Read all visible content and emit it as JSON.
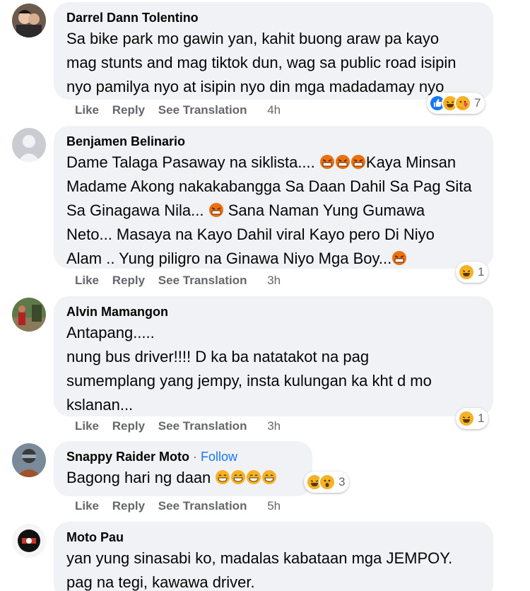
{
  "comments": [
    {
      "author": "Darrel Dann Tolentino",
      "lines": [
        "Sa bike park mo gawin yan, kahit buong araw pa kayo",
        "mag stunts and mag tiktok dun, wag sa public road isipin",
        "nyo pamilya nyo at isipin nyo din mga madadamay nyo"
      ],
      "actions": {
        "like": "Like",
        "reply": "Reply",
        "translate": "See Translation",
        "time": "4h"
      },
      "reaction_count": "7",
      "reaction_icons": [
        "like-reaction-icon",
        "haha-reaction-icon",
        "care-reaction-icon"
      ]
    },
    {
      "author": "Benjamen Belinario",
      "lines": [
        "Dame Talaga Pasaway na siklista....",
        "Kaya Minsan",
        "Madame Akong nakakabangga Sa Daan Dahil Sa Pag Sita",
        "Sa Ginagawa Nila...",
        "Sana Naman Yung Gumawa",
        "Neto... Masaya na Kayo Dahil viral Kayo pero Di Niyo",
        "Alam .. Yung piligro na Ginawa Niyo Mga Boy..."
      ],
      "actions": {
        "like": "Like",
        "reply": "Reply",
        "translate": "See Translation",
        "time": "3h"
      },
      "reaction_count": "1",
      "reaction_icons": [
        "haha-reaction-icon"
      ]
    },
    {
      "author": "Alvin Mamangon",
      "lines": [
        "Antapang.....",
        "nung bus driver!!!! D ka ba natatakot na pag",
        "sumemplang yang jempy, insta kulungan ka kht d mo",
        "kslanan..."
      ],
      "actions": {
        "like": "Like",
        "reply": "Reply",
        "translate": "See Translation",
        "time": "3h"
      },
      "reaction_count": "1",
      "reaction_icons": [
        "haha-reaction-icon"
      ]
    },
    {
      "author": "Snappy Raider Moto",
      "separator": "·",
      "follow": "Follow",
      "lines": [
        "Bagong hari ng daan"
      ],
      "actions": {
        "like": "Like",
        "reply": "Reply",
        "translate": "See Translation",
        "time": "5h"
      },
      "reaction_count": "3",
      "reaction_icons": [
        "haha-reaction-icon",
        "wow-reaction-icon"
      ]
    },
    {
      "author": "Moto Pau",
      "lines": [
        "yan yung sinasabi ko, madalas kabataan mga JEMPOY.",
        "pag na tegi, kawawa driver."
      ]
    }
  ],
  "colors": {
    "bubble": "#f0f2f5",
    "meta_text": "#65676b",
    "follow": "#1877f2",
    "like_blue": "#1877f2",
    "emoji_yellow": "#f7b125",
    "angry_red": "#e9710f"
  }
}
